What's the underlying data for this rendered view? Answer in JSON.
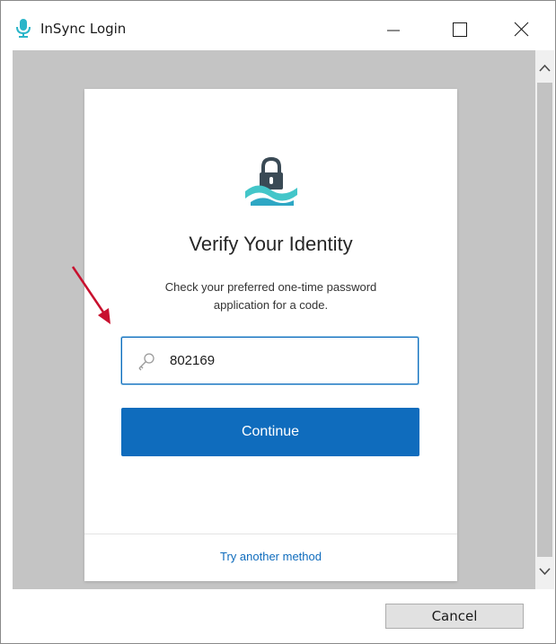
{
  "window": {
    "title": "InSync Login",
    "icon": "microphone-icon",
    "controls": [
      "minimize-icon",
      "maximize-icon",
      "close-icon"
    ]
  },
  "card": {
    "icon": "lock-icon",
    "title": "Verify Your Identity",
    "description": "Check your preferred one-time password application for a code.",
    "code_field": {
      "icon": "key-icon",
      "value": "802169"
    },
    "continue_label": "Continue",
    "alt_method_label": "Try another method"
  },
  "footer": {
    "cancel_label": "Cancel"
  },
  "colors": {
    "accent": "#0f6cbd",
    "app_icon": "#2ab5c9",
    "annotation": "#c8102e",
    "backdrop": "#c4c4c4"
  }
}
